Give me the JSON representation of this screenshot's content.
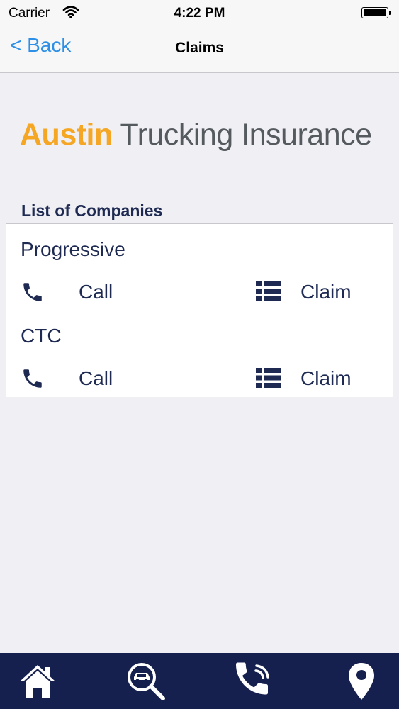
{
  "status_bar": {
    "carrier": "Carrier",
    "time": "4:22 PM",
    "icons": [
      "wifi-icon",
      "battery-icon"
    ]
  },
  "nav_bar": {
    "back_label": "< Back",
    "title": "Claims"
  },
  "logo": {
    "brand_word": "Austin",
    "brand_rest": " Trucking Insurance",
    "colors": {
      "brand_word": "#f5a623",
      "brand_rest": "#555a5e"
    }
  },
  "section": {
    "title": "List of Companies"
  },
  "companies": [
    {
      "name": "Progressive",
      "call_label": "Call",
      "claim_label": "Claim",
      "call_icon": "phone-icon",
      "claim_icon": "list-icon"
    },
    {
      "name": "CTC",
      "call_label": "Call",
      "claim_label": "Claim",
      "call_icon": "phone-icon",
      "claim_icon": "list-icon"
    }
  ],
  "tab_bar": {
    "tabs": [
      "home-icon",
      "car-search-icon",
      "phone-calling-icon",
      "location-pin-icon"
    ]
  },
  "colors": {
    "accent": "#2e8fe6",
    "text": "#1e2a52",
    "tab_bar_background": "#16204f",
    "background": "#efeff4"
  }
}
